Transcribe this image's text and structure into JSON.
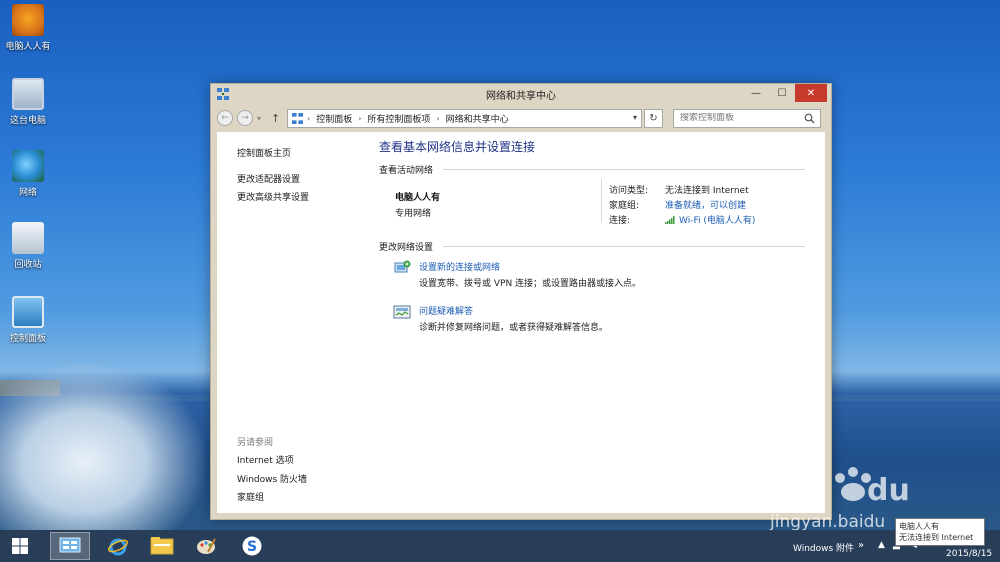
{
  "desktop": {
    "icons": [
      {
        "label": "电脑人人有",
        "icon": "lion-logo-icon"
      },
      {
        "label": "这台电脑",
        "icon": "computer-icon"
      },
      {
        "label": "网络",
        "icon": "network-globe-icon"
      },
      {
        "label": "回收站",
        "icon": "recycle-bin-icon"
      },
      {
        "label": "控制面板",
        "icon": "control-panel-icon"
      }
    ]
  },
  "window": {
    "title": "网络和共享中心",
    "controls": {
      "minimize": "—",
      "maximize": "☐",
      "close": "✕"
    }
  },
  "addressbar": {
    "breadcrumbs": [
      "控制面板",
      "所有控制面板项",
      "网络和共享中心"
    ],
    "search_placeholder": "搜索控制面板"
  },
  "sidebar": {
    "home": "控制面板主页",
    "links": [
      "更改适配器设置",
      "更改高级共享设置"
    ],
    "see_also_heading": "另请参阅",
    "see_also": [
      "Internet 选项",
      "Windows 防火墙",
      "家庭组"
    ]
  },
  "main": {
    "title": "查看基本网络信息并设置连接",
    "active_networks_label": "查看活动网络",
    "network": {
      "name": "电脑人人有",
      "category": "专用网络",
      "access_type_label": "访问类型:",
      "access_type_value": "无法连接到 Internet",
      "homegroup_label": "家庭组:",
      "homegroup_value": "准备就绪，可以创建",
      "connection_label": "连接:",
      "connection_value": "Wi-Fi (电脑人人有)"
    },
    "change_settings_label": "更改网络设置",
    "tasks": [
      {
        "link": "设置新的连接或网络",
        "desc": "设置宽带、拨号或 VPN 连接；或设置路由器或接入点。",
        "icon": "new-connection-icon"
      },
      {
        "link": "问题疑难解答",
        "desc": "诊断并修复网络问题，或者获得疑难解答信息。",
        "icon": "troubleshoot-icon"
      }
    ]
  },
  "taskbar": {
    "tray_text": "Windows 附件",
    "date": "2015/8/15"
  },
  "tooltip": {
    "line1": "电脑人人有",
    "line2": "无法连接到 Internet"
  },
  "watermark": {
    "url_text": "jingyan.baidu"
  },
  "colors": {
    "link": "#1c5db5",
    "title": "#1e3287",
    "close_button": "#c7392c",
    "window_frame": "#ddd6c4"
  }
}
